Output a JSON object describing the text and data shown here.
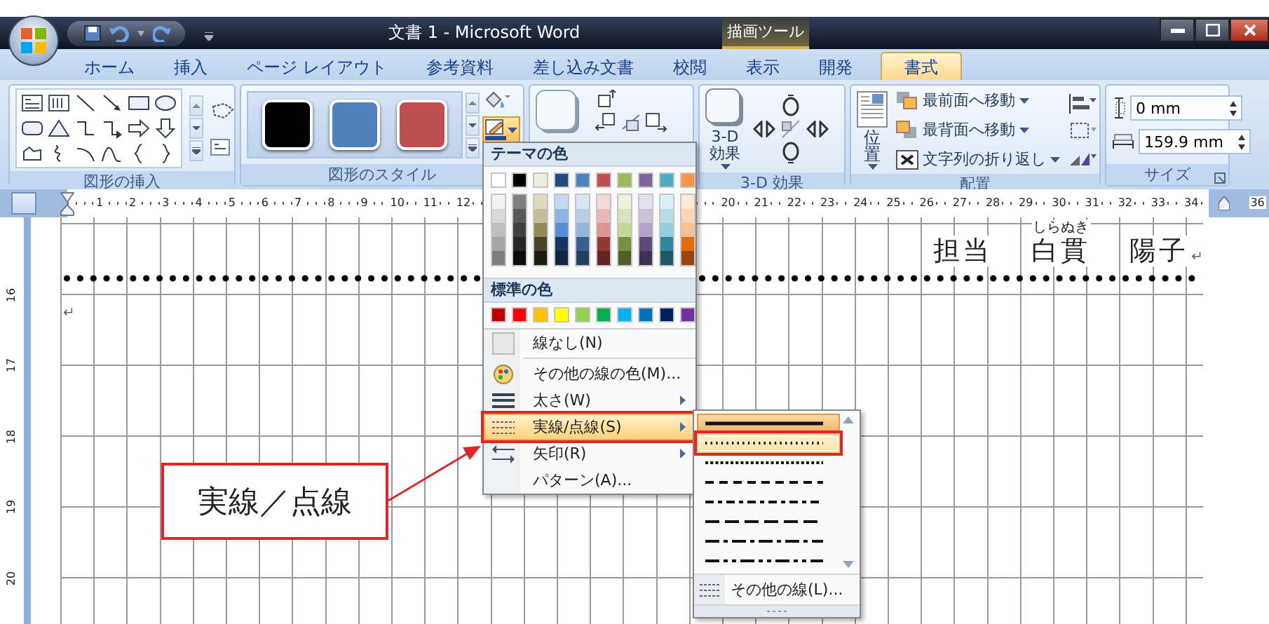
{
  "title_bar": {
    "title": "文書 1 - Microsoft Word",
    "context_tab": "描画ツール"
  },
  "tabs": [
    {
      "label": "ホーム",
      "selected": false
    },
    {
      "label": "挿入",
      "selected": false
    },
    {
      "label": "ページ レイアウト",
      "selected": false
    },
    {
      "label": "参考資料",
      "selected": false
    },
    {
      "label": "差し込み文書",
      "selected": false
    },
    {
      "label": "校閲",
      "selected": false
    },
    {
      "label": "表示",
      "selected": false
    },
    {
      "label": "開発",
      "selected": false
    },
    {
      "label": "書式",
      "selected": true
    }
  ],
  "ribbon": {
    "insert_shapes": {
      "label": "図形の挿入"
    },
    "shape_styles": {
      "label": "図形のスタイル",
      "swatches": [
        {
          "color": "#000000"
        },
        {
          "color": "#4f81bd"
        },
        {
          "color": "#c0504d"
        }
      ],
      "line_color_button": {
        "expanded": true
      }
    },
    "three_d": {
      "label": "3-D 効果",
      "button": "3-D\n効果"
    },
    "arrange": {
      "label": "配置",
      "position_button": "位置",
      "commands": [
        "最前面へ移動",
        "最背面へ移動",
        "文字列の折り返し"
      ]
    },
    "size": {
      "label": "サイズ",
      "fields": [
        {
          "value": "0 mm"
        },
        {
          "value": "159.9 mm"
        }
      ]
    }
  },
  "ruler": {
    "left_numbers": [
      "1",
      "2",
      "3",
      "4",
      "5",
      "6",
      "7",
      "8",
      "9",
      "10",
      "11",
      "12"
    ],
    "right_numbers": [
      "20",
      "21",
      "22",
      "23",
      "24",
      "25",
      "26",
      "27",
      "28",
      "29",
      "30",
      "31",
      "32",
      "33",
      "34"
    ],
    "end_number": "36",
    "vertical_numbers": [
      "16",
      "17",
      "18",
      "19",
      "20"
    ]
  },
  "document": {
    "signature": [
      {
        "text": "担当"
      },
      {
        "text": "白貫",
        "ruby": "しらぬき"
      },
      {
        "text": "陽子"
      }
    ],
    "end_mark": "↵",
    "empty_line_mark": "↵"
  },
  "line_menu": {
    "theme_header": "テーマの色",
    "standard_header": "標準の色",
    "theme_colors": [
      {
        "color": "#ffffff",
        "shades": [
          {
            "color": "#f2f2f2"
          },
          {
            "color": "#d8d8d8"
          },
          {
            "color": "#bfbfbf"
          },
          {
            "color": "#a5a5a5"
          },
          {
            "color": "#7f7f7f"
          }
        ]
      },
      {
        "color": "#000000",
        "shades": [
          {
            "color": "#7f7f7f"
          },
          {
            "color": "#595959"
          },
          {
            "color": "#3f3f3f"
          },
          {
            "color": "#262626"
          },
          {
            "color": "#0c0c0c"
          }
        ]
      },
      {
        "color": "#eeece1",
        "shades": [
          {
            "color": "#ddd9c3"
          },
          {
            "color": "#c4bd97"
          },
          {
            "color": "#938953"
          },
          {
            "color": "#494429"
          },
          {
            "color": "#1d1b10"
          }
        ]
      },
      {
        "color": "#1f497d",
        "shades": [
          {
            "color": "#c6d9f0"
          },
          {
            "color": "#8db3e2"
          },
          {
            "color": "#548dd4"
          },
          {
            "color": "#17365d"
          },
          {
            "color": "#0f243e"
          }
        ]
      },
      {
        "color": "#4f81bd",
        "shades": [
          {
            "color": "#dbe5f1"
          },
          {
            "color": "#b8cce4"
          },
          {
            "color": "#95b3d7"
          },
          {
            "color": "#366092"
          },
          {
            "color": "#244061"
          }
        ]
      },
      {
        "color": "#c0504d",
        "shades": [
          {
            "color": "#f2dcdb"
          },
          {
            "color": "#e5b9b7"
          },
          {
            "color": "#d99694"
          },
          {
            "color": "#953734"
          },
          {
            "color": "#632423"
          }
        ]
      },
      {
        "color": "#9bbb59",
        "shades": [
          {
            "color": "#ebf1dd"
          },
          {
            "color": "#d7e3bc"
          },
          {
            "color": "#c3d69b"
          },
          {
            "color": "#76923c"
          },
          {
            "color": "#4f6128"
          }
        ]
      },
      {
        "color": "#8064a2",
        "shades": [
          {
            "color": "#e5e0ec"
          },
          {
            "color": "#ccc1d9"
          },
          {
            "color": "#b2a2c7"
          },
          {
            "color": "#5f497a"
          },
          {
            "color": "#3f3151"
          }
        ]
      },
      {
        "color": "#4bacc6",
        "shades": [
          {
            "color": "#dbeef3"
          },
          {
            "color": "#b7dde8"
          },
          {
            "color": "#92cddc"
          },
          {
            "color": "#31859b"
          },
          {
            "color": "#205867"
          }
        ]
      },
      {
        "color": "#f79646",
        "shades": [
          {
            "color": "#fdeada"
          },
          {
            "color": "#fbd5b5"
          },
          {
            "color": "#fac08f"
          },
          {
            "color": "#e36c09"
          },
          {
            "color": "#974806"
          }
        ]
      }
    ],
    "standard_colors": [
      {
        "color": "#c00000"
      },
      {
        "color": "#ff0000"
      },
      {
        "color": "#ffc000"
      },
      {
        "color": "#ffff00"
      },
      {
        "color": "#92d050"
      },
      {
        "color": "#00b050"
      },
      {
        "color": "#00b0f0"
      },
      {
        "color": "#0070c0"
      },
      {
        "color": "#002060"
      },
      {
        "color": "#7030a0"
      }
    ],
    "items": [
      {
        "label": "線なし(N)",
        "has_submenu": false,
        "selected": false,
        "annotated": false
      },
      {
        "label": "その他の線の色(M)...",
        "has_submenu": false,
        "selected": false,
        "annotated": false
      },
      {
        "label": "太さ(W)",
        "has_submenu": true,
        "selected": false,
        "annotated": false
      },
      {
        "label": "実線/点線(S)",
        "has_submenu": true,
        "selected": true,
        "annotated": true
      },
      {
        "label": "矢印(R)",
        "has_submenu": true,
        "selected": false,
        "annotated": false
      },
      {
        "label": "パターン(A)...",
        "has_submenu": false,
        "selected": false,
        "annotated": false
      }
    ]
  },
  "dash_submenu": {
    "styles": [
      {
        "selected": true,
        "hovered": false,
        "annotated": false
      },
      {
        "selected": false,
        "hovered": true,
        "annotated": true
      },
      {
        "selected": false,
        "hovered": false,
        "annotated": false
      },
      {
        "selected": false,
        "hovered": false,
        "annotated": false
      },
      {
        "selected": false,
        "hovered": false,
        "annotated": false
      },
      {
        "selected": false,
        "hovered": false,
        "annotated": false
      },
      {
        "selected": false,
        "hovered": false,
        "annotated": false
      },
      {
        "selected": false,
        "hovered": false,
        "annotated": false
      }
    ],
    "more_item": "その他の線(L)..."
  },
  "callout": {
    "text": "実線／点線"
  }
}
